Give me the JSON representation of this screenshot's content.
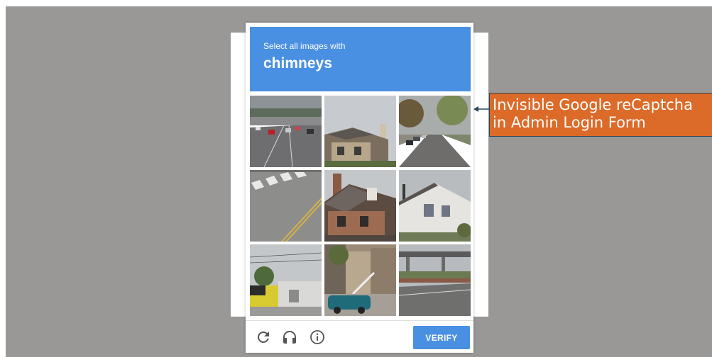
{
  "captcha": {
    "prompt": "Select all images with",
    "target": "chimneys",
    "tiles": [
      {
        "label": "highway-traffic"
      },
      {
        "label": "house-with-chimney"
      },
      {
        "label": "residential-street"
      },
      {
        "label": "road-crosswalk"
      },
      {
        "label": "brick-house-chimney"
      },
      {
        "label": "house-siding"
      },
      {
        "label": "commercial-building"
      },
      {
        "label": "townhouses-car"
      },
      {
        "label": "overpass-road"
      }
    ],
    "footer": {
      "reload_icon": "reload-icon",
      "audio_icon": "headphones-icon",
      "info_icon": "info-icon",
      "verify_label": "VERIFY"
    },
    "colors": {
      "accent": "#4a90e2",
      "overlay": "#999897"
    }
  },
  "annotation": {
    "line1": "Invisible Google reCaptcha",
    "line2": "in Admin Login Form",
    "color": "#dc6a28"
  }
}
